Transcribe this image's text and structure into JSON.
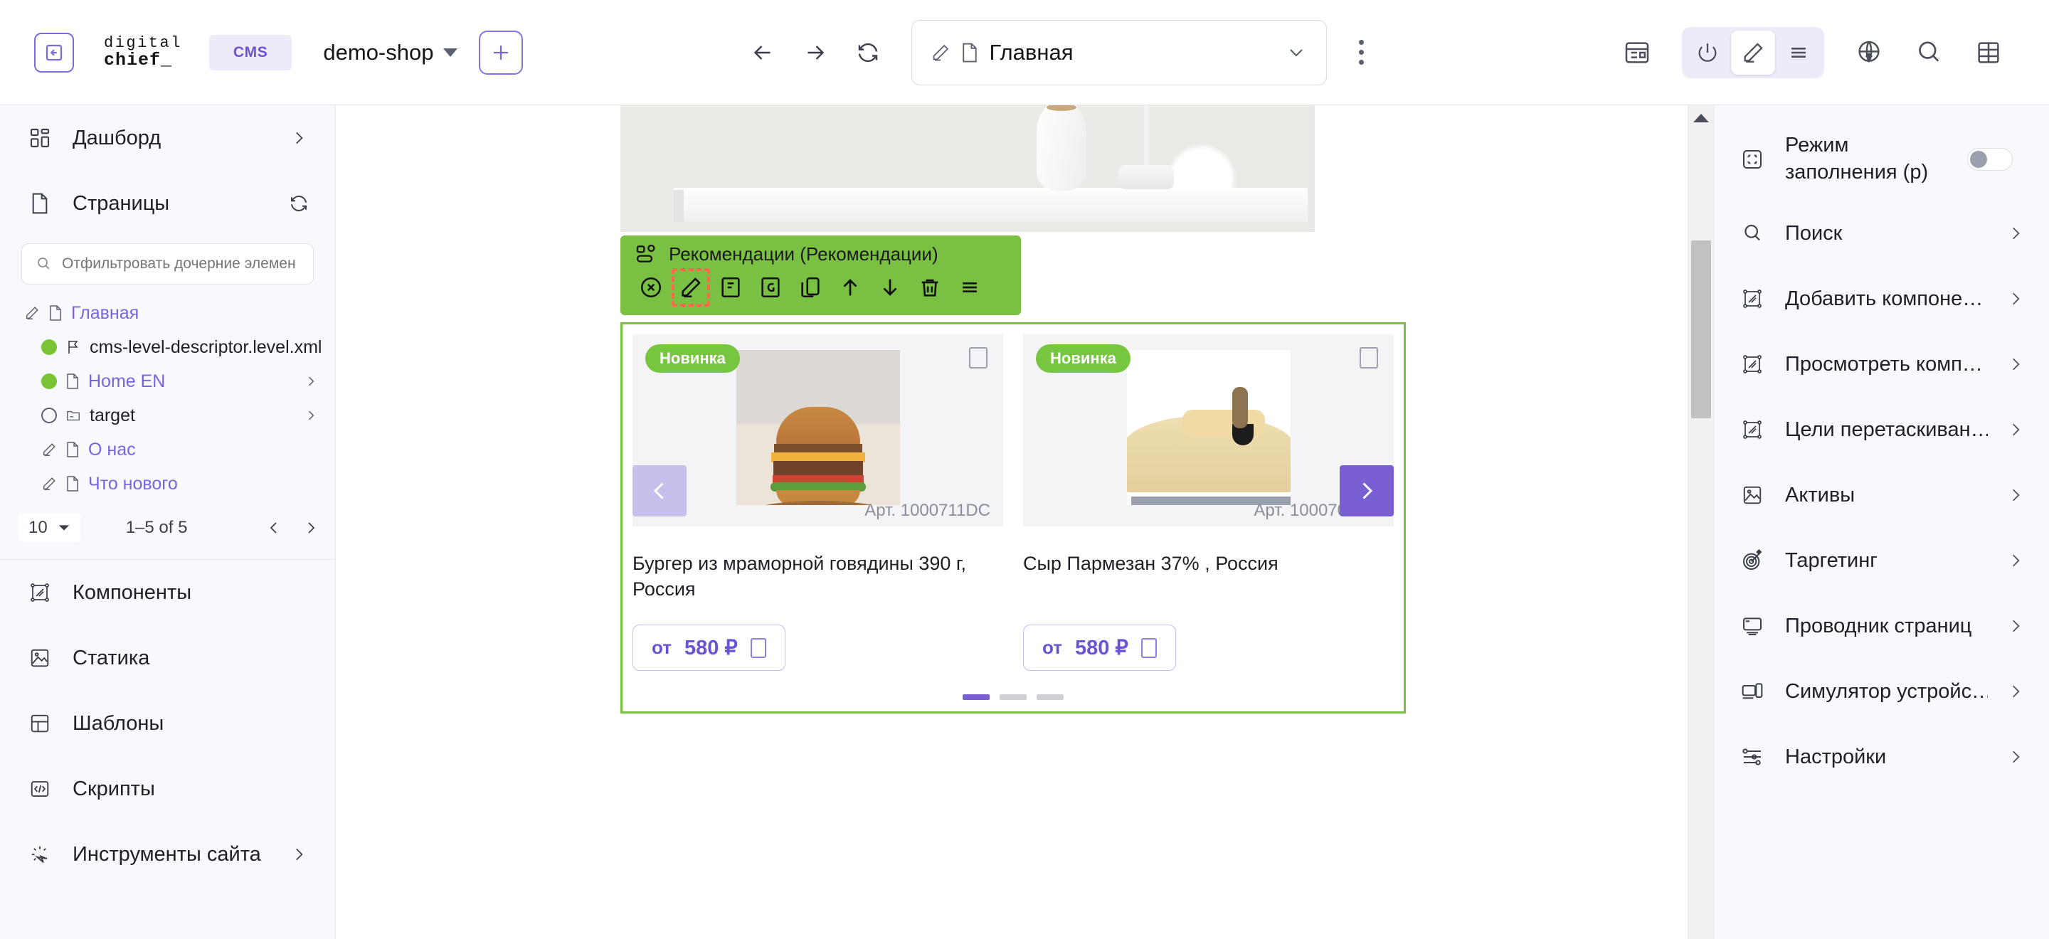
{
  "topbar": {
    "collapse_icon": "panel-collapse-icon",
    "logo_line1": "digital",
    "logo_line2": "chief_",
    "cms_badge": "CMS",
    "site_name": "demo-shop",
    "add_label": "+",
    "back_icon": "arrow-left-icon",
    "forward_icon": "arrow-right-icon",
    "refresh_icon": "refresh-icon",
    "page_field_value": "Главная",
    "page_field_edit_icon": "pencil-icon",
    "page_field_doc_icon": "document-icon",
    "kebab_icon": "more-vertical-icon",
    "right_icons": [
      "layout-icon",
      "power-icon",
      "pencil-icon",
      "menu-icon",
      "publish-globe-icon",
      "search-icon",
      "grid-icon"
    ],
    "active_mode": "pencil-icon"
  },
  "sidebar": {
    "dashboard": {
      "label": "Дашборд",
      "icon": "dashboard-icon"
    },
    "pages": {
      "label": "Страницы",
      "icon": "document-icon",
      "refresh_icon": "refresh-icon"
    },
    "filter": {
      "placeholder": "Отфильтровать дочерние элемен",
      "icon": "search-icon"
    },
    "tree": [
      {
        "label": "Главная",
        "icon": "document-icon",
        "lead_icon": "pencil-icon",
        "status": "none",
        "link": true,
        "chevron": false,
        "depth": 0
      },
      {
        "label": "cms-level-descriptor.level.xml",
        "icon": "flag-icon",
        "status": "published",
        "link": false,
        "chevron": false,
        "depth": 1
      },
      {
        "label": "Home EN",
        "icon": "document-icon",
        "status": "published",
        "link": true,
        "chevron": true,
        "depth": 1
      },
      {
        "label": "target",
        "icon": "folder-icon",
        "status": "unpublished",
        "link": false,
        "chevron": true,
        "depth": 1
      },
      {
        "label": "О нас",
        "icon": "document-icon",
        "lead_icon": "pencil-icon",
        "status": "none",
        "link": true,
        "chevron": false,
        "depth": 1
      },
      {
        "label": "Что нового",
        "icon": "document-icon",
        "lead_icon": "pencil-icon",
        "status": "none",
        "link": true,
        "chevron": false,
        "depth": 1
      }
    ],
    "pager": {
      "page_size": "10",
      "range": "1–5 of 5",
      "prev_icon": "chevron-left-icon",
      "next_icon": "chevron-right-icon"
    },
    "nav": [
      {
        "label": "Компоненты",
        "icon": "component-icon",
        "chevron": false
      },
      {
        "label": "Статика",
        "icon": "image-icon",
        "chevron": false
      },
      {
        "label": "Шаблоны",
        "icon": "template-icon",
        "chevron": false
      },
      {
        "label": "Скрипты",
        "icon": "code-icon",
        "chevron": false
      },
      {
        "label": "Инструменты сайта",
        "icon": "tools-icon",
        "chevron": true
      }
    ]
  },
  "canvas": {
    "component_toolbar": {
      "title": "Рекомендации (Рекомендации)",
      "title_icon": "component-group-icon",
      "actions": [
        {
          "name": "close-icon",
          "glyph": "x-circle"
        },
        {
          "name": "edit-icon",
          "glyph": "pencil",
          "selected": true
        },
        {
          "name": "form-icon",
          "glyph": "F"
        },
        {
          "name": "group-icon",
          "glyph": "G"
        },
        {
          "name": "duplicate-icon",
          "glyph": "copy"
        },
        {
          "name": "move-up-icon",
          "glyph": "arrow-up"
        },
        {
          "name": "move-down-icon",
          "glyph": "arrow-down"
        },
        {
          "name": "delete-icon",
          "glyph": "trash"
        },
        {
          "name": "more-icon",
          "glyph": "menu"
        }
      ]
    },
    "carousel": {
      "prev_icon": "chevron-left-icon",
      "next_icon": "chevron-right-icon",
      "dots": [
        true,
        false,
        false
      ],
      "products": [
        {
          "badge": "Новинка",
          "sku": "Арт. 1000711DC",
          "title": "Бургер из мраморной говядины 390 г, Россия",
          "price_prefix": "от",
          "price": "580 ₽",
          "image": "burger-photo",
          "favorite_icon": "favorite-icon",
          "cart_icon": "cart-icon"
        },
        {
          "badge": "Новинка",
          "sku": "Арт. 1000709DC",
          "title": "Сыр Пармезан 37% , Россия",
          "price_prefix": "от",
          "price": "580 ₽",
          "image": "parmesan-photo",
          "favorite_icon": "favorite-icon",
          "cart_icon": "cart-icon"
        }
      ]
    },
    "hero_image_alt": "white-shelf-with-vase-photo"
  },
  "rightpanel": {
    "fill_mode": {
      "label": "Режим заполнения (p)",
      "icon": "fill-mode-icon",
      "enabled": false
    },
    "items": [
      {
        "label": "Поиск",
        "icon": "search-icon"
      },
      {
        "label": "Добавить компоне…",
        "icon": "component-icon"
      },
      {
        "label": "Просмотреть комп…",
        "icon": "component-icon"
      },
      {
        "label": "Цели перетаскиван…",
        "icon": "component-icon"
      },
      {
        "label": "Активы",
        "icon": "image-icon"
      },
      {
        "label": "Таргетинг",
        "icon": "target-icon"
      },
      {
        "label": "Проводник страниц",
        "icon": "monitor-icon"
      },
      {
        "label": "Симулятор устройс…",
        "icon": "devices-icon"
      },
      {
        "label": "Настройки",
        "icon": "sliders-icon"
      }
    ]
  },
  "colors": {
    "accent_purple": "#7a5fd3",
    "accent_green": "#7ac143",
    "badge_green": "#76c63f",
    "selection_orange": "#ff6a4d",
    "sidebar_bg": "#f8f9fc"
  }
}
